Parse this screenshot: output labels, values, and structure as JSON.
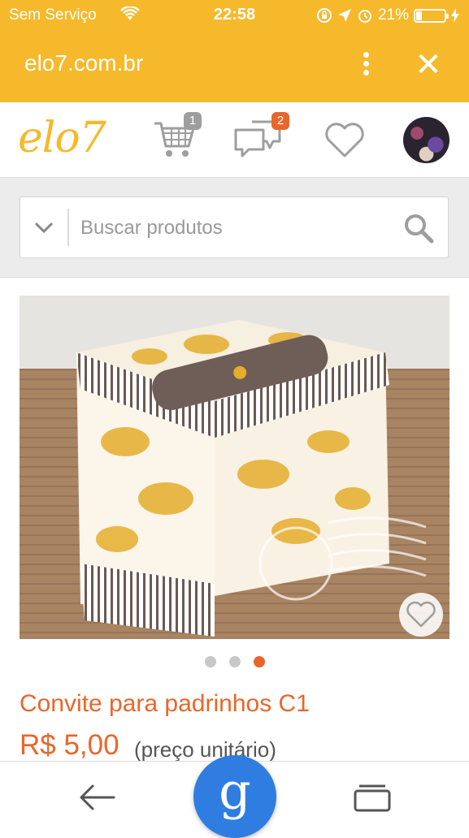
{
  "status_bar": {
    "carrier": "Sem Serviço",
    "time": "22:58",
    "battery": "21%"
  },
  "browser": {
    "url": "elo7.com.br",
    "menu_icon": "kebab-menu-icon",
    "close_icon": "close-icon"
  },
  "header": {
    "logo": "elo7",
    "cart_count": "1",
    "messages_count": "2",
    "brand_color": "#f6b92c",
    "badge_cart_color": "#9e9e9e",
    "badge_messages_color": "#e8662a"
  },
  "search": {
    "placeholder": "Buscar produtos"
  },
  "product": {
    "title": "Convite para padrinhos C1",
    "price": "R$ 5,00",
    "price_note": "(preço unitário)",
    "image_count": 3,
    "active_image": 3,
    "accent_color": "#e8662a"
  },
  "bottom_nav": {
    "center_glyph": "g",
    "center_color": "#2f7de1"
  }
}
